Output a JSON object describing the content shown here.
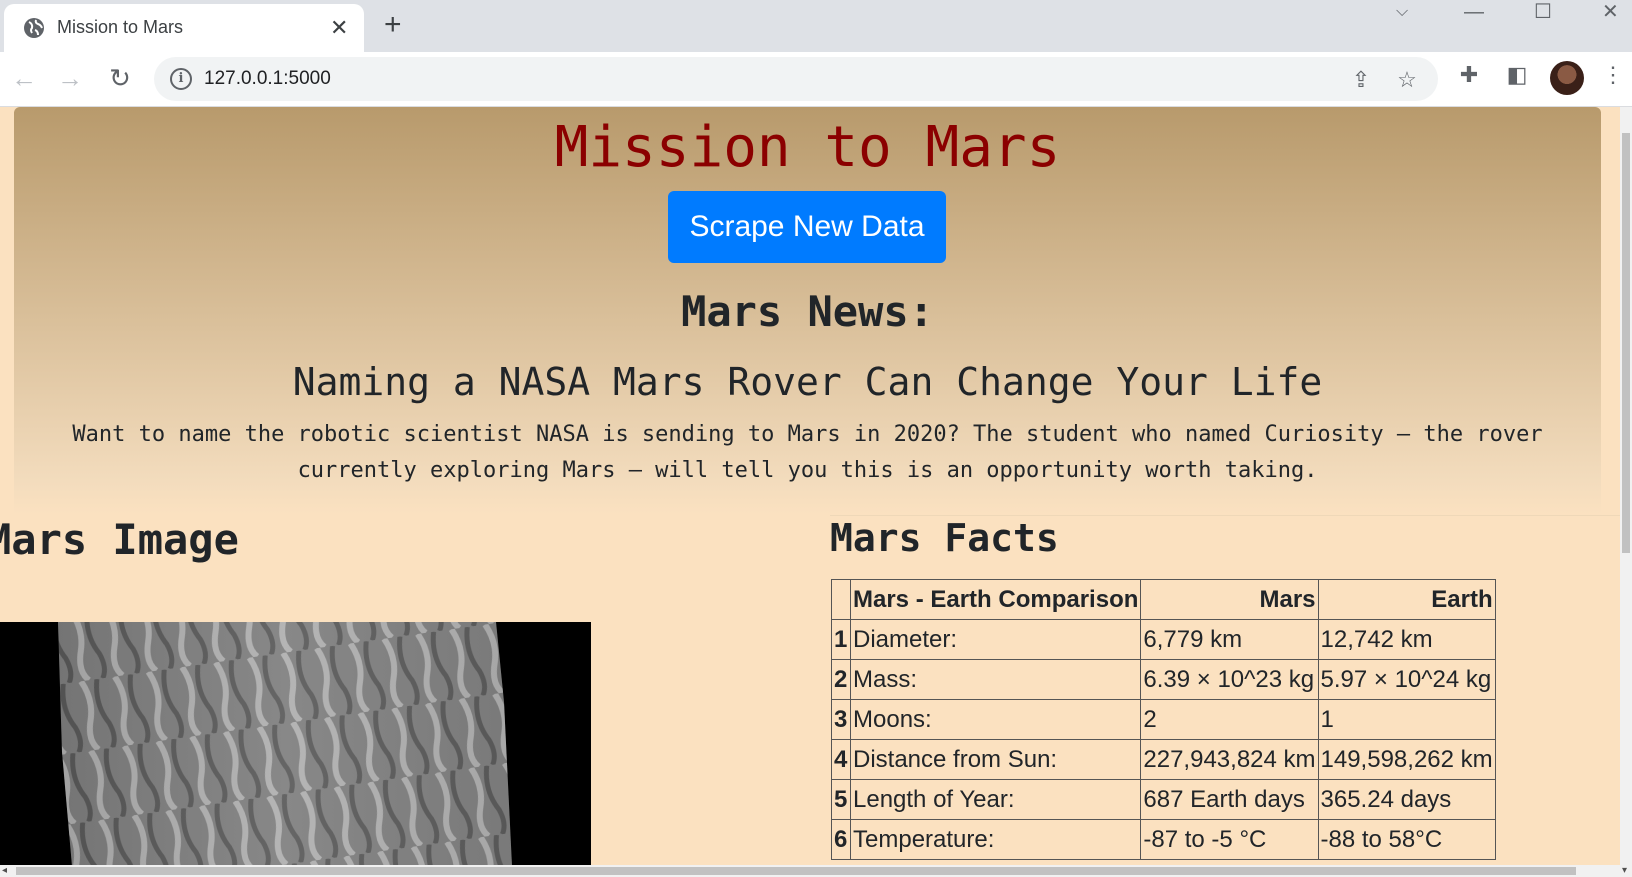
{
  "browser": {
    "tab_title": "Mission to Mars",
    "tab_close": "✕",
    "new_tab": "+",
    "url": "127.0.0.1:5000"
  },
  "page": {
    "title": "Mission to Mars",
    "scrape_button": "Scrape New Data",
    "news_heading": "Mars News:",
    "news_title": "Naming a NASA Mars Rover Can Change Your Life",
    "news_paragraph": "Want to name the robotic scientist NASA is sending to Mars in 2020? The student who named Curiosity — the rover currently exploring Mars — will tell you this is an opportunity worth taking.",
    "image_heading": "Mars Image",
    "facts_heading": "Mars Facts"
  },
  "facts_table": {
    "headers": [
      "",
      "Mars - Earth Comparison",
      "Mars",
      "Earth"
    ],
    "rows": [
      [
        "1",
        "Diameter:",
        "6,779 km",
        "12,742 km"
      ],
      [
        "2",
        "Mass:",
        "6.39 × 10^23 kg",
        "5.97 × 10^24 kg"
      ],
      [
        "3",
        "Moons:",
        "2",
        "1"
      ],
      [
        "4",
        "Distance from Sun:",
        "227,943,824 km",
        "149,598,262 km"
      ],
      [
        "5",
        "Length of Year:",
        "687 Earth days",
        "365.24 days"
      ],
      [
        "6",
        "Temperature:",
        "-87 to -5 °C",
        "-88 to 58°C"
      ]
    ]
  },
  "colors": {
    "title": "#8b0000",
    "button": "#007bff",
    "page_bg": "#fbe1c0"
  },
  "icons": [
    "globe-icon",
    "back-icon",
    "forward-icon",
    "reload-icon",
    "info-icon",
    "share-icon",
    "star-icon",
    "extensions-icon",
    "side-panel-icon",
    "menu-icon"
  ]
}
